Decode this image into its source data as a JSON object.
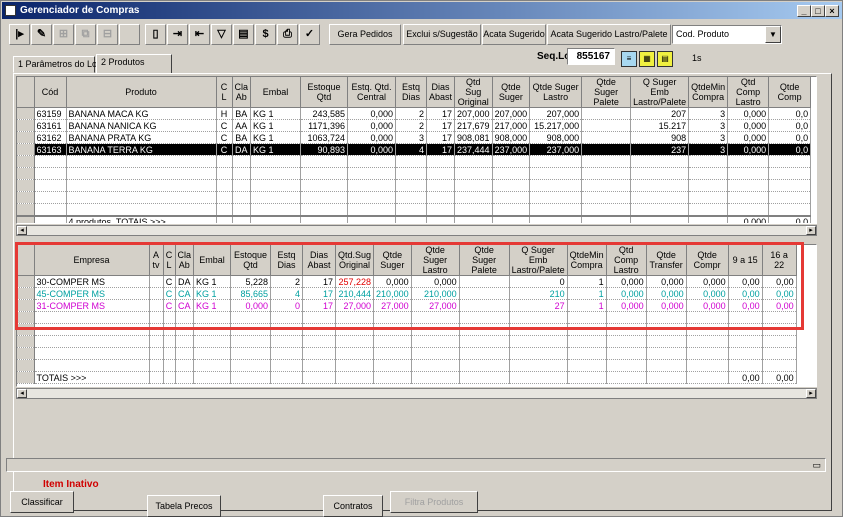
{
  "window": {
    "title": "Gerenciador de Compras"
  },
  "toolbar": {
    "gera_pedidos": "Gera Pedidos",
    "exclui_sugestao": "Exclui s/Sugestão",
    "acata_sugerido": "Acata Sugerido",
    "acata_lastro": "Acata Sugerido Lastro/Palete",
    "sort_select": "Cod. Produto"
  },
  "seq": {
    "label": "Seq.Lote",
    "value": "855167",
    "seconds": "1s"
  },
  "tabs": [
    "1 Parâmetros do Lote",
    "2 Produtos"
  ],
  "products": {
    "headers": [
      "Cód",
      "Produto",
      "C L",
      "Cla Ab",
      "Embal",
      "Estoque Qtd",
      "Estq. Qtd. Central",
      "Estq Dias",
      "Dias Abast",
      "Qtd Sug Original",
      "Qtde Suger",
      "Qtde Suger Lastro",
      "Qtde Suger Palete",
      "Q Suger Emb Lastro/Palete",
      "QtdeMin Compra",
      "Qtd Comp Lastro",
      "Qtde Comp"
    ],
    "rows": [
      [
        "63159",
        "BANANA MACA KG",
        "H",
        "BA",
        "KG 1",
        "243,585",
        "0,000",
        "2",
        "17",
        "207,000",
        "207,000",
        "207,000",
        "",
        "207",
        "3",
        "0,000",
        "0,0"
      ],
      [
        "63161",
        "BANANA NANICA KG",
        "C",
        "AA",
        "KG 1",
        "1171,396",
        "0,000",
        "2",
        "17",
        "217,679",
        "217,000",
        "15.217,000",
        "",
        "15.217",
        "3",
        "0,000",
        "0,0"
      ],
      [
        "63162",
        "BANANA PRATA KG",
        "C",
        "BA",
        "KG 1",
        "1063,724",
        "0,000",
        "3",
        "17",
        "908,081",
        "908,000",
        "908,000",
        "",
        "908",
        "3",
        "0,000",
        "0,0"
      ],
      [
        "63163",
        "BANANA TERRA KG",
        "C",
        "DA",
        "KG 1",
        "90,893",
        "0,000",
        "4",
        "17",
        "237,444",
        "237,000",
        "237,000",
        "",
        "237",
        "3",
        "0,000",
        "0,0"
      ]
    ],
    "totals_label": "4 produtos. TOTAIS >>>",
    "totals_comp_lastro": "0,000",
    "totals_comp": "0,0"
  },
  "empresas": {
    "headers": [
      "Empresa",
      "A tv",
      "C L",
      "Cla Ab",
      "Embal",
      "Estoque Qtd",
      "Estq Dias",
      "Dias Abast",
      "Qtd.Sug Original",
      "Qtde Suger",
      "Qtde Suger Lastro",
      "Qtde Suger Palete",
      "Q Suger Emb Lastro/Palete",
      "QtdeMin Compra",
      "Qtd Comp Lastro",
      "Qtde Transfer",
      "Qtde Compr",
      "9 a 15",
      "16 a 22"
    ],
    "rows": [
      {
        "color": "#000000",
        "orig_color": "#e00000",
        "cells": [
          "30-COMPER MS",
          "",
          "C",
          "DA",
          "KG 1",
          "5,228",
          "2",
          "17",
          "257,228",
          "0,000",
          "0,000",
          "",
          "0",
          "1",
          "0,000",
          "0,000",
          "0,000",
          "0,00",
          "0,00"
        ]
      },
      {
        "color": "#00a0a0",
        "orig_color": "#00a0a0",
        "cells": [
          "45-COMPER MS",
          "",
          "C",
          "CA",
          "KG 1",
          "85,665",
          "4",
          "17",
          "210,444",
          "210,000",
          "210,000",
          "",
          "210",
          "1",
          "0,000",
          "0,000",
          "0,000",
          "0,00",
          "0,00"
        ]
      },
      {
        "color": "#d000d0",
        "orig_color": "#d000d0",
        "cells": [
          "31-COMPER MS",
          "",
          "C",
          "CA",
          "KG 1",
          "0,000",
          "0",
          "17",
          "27,000",
          "27,000",
          "27,000",
          "",
          "27",
          "1",
          "0,000",
          "0,000",
          "0,000",
          "0,00",
          "0,00"
        ]
      }
    ],
    "totals_label": "TOTAIS >>>",
    "totals_a": "0,00",
    "totals_b": "0,00"
  },
  "status": {
    "item_inativo": "Item Inativo"
  },
  "bottom": {
    "classificar": "Classificar",
    "tabela_precos": "Tabela Precos",
    "contratos": "Contratos",
    "filtra_produtos": "Filtra Produtos"
  },
  "colors": {
    "highlight_box": "#e53935",
    "title_bar": "#0a246a",
    "inactive_label": "#d00000"
  }
}
